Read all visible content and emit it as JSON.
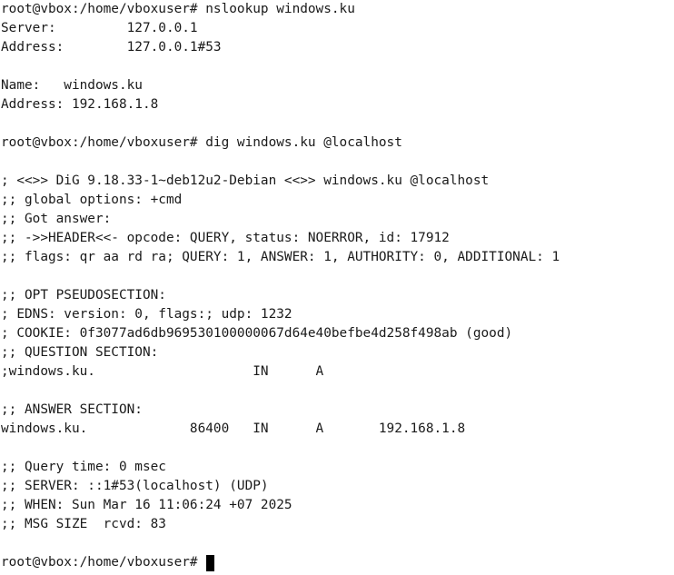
{
  "terminal": {
    "cursor_color": "#000000",
    "text_color": "#1a1a1a",
    "background": "#ffffff",
    "lines": [
      "root@vbox:/home/vboxuser# nslookup windows.ku",
      "Server:         127.0.0.1",
      "Address:        127.0.0.1#53",
      "",
      "Name:   windows.ku",
      "Address: 192.168.1.8",
      "",
      "root@vbox:/home/vboxuser# dig windows.ku @localhost",
      "",
      "; <<>> DiG 9.18.33-1~deb12u2-Debian <<>> windows.ku @localhost",
      ";; global options: +cmd",
      ";; Got answer:",
      ";; ->>HEADER<<- opcode: QUERY, status: NOERROR, id: 17912",
      ";; flags: qr aa rd ra; QUERY: 1, ANSWER: 1, AUTHORITY: 0, ADDITIONAL: 1",
      "",
      ";; OPT PSEUDOSECTION:",
      "; EDNS: version: 0, flags:; udp: 1232",
      "; COOKIE: 0f3077ad6db969530100000067d64e40befbe4d258f498ab (good)",
      ";; QUESTION SECTION:",
      ";windows.ku.                    IN      A",
      "",
      ";; ANSWER SECTION:",
      "windows.ku.             86400   IN      A       192.168.1.8",
      "",
      ";; Query time: 0 msec",
      ";; SERVER: ::1#53(localhost) (UDP)",
      ";; WHEN: Sun Mar 16 11:06:24 +07 2025",
      ";; MSG SIZE  rcvd: 83",
      ""
    ],
    "prompt": "root@vbox:/home/vboxuser# "
  }
}
